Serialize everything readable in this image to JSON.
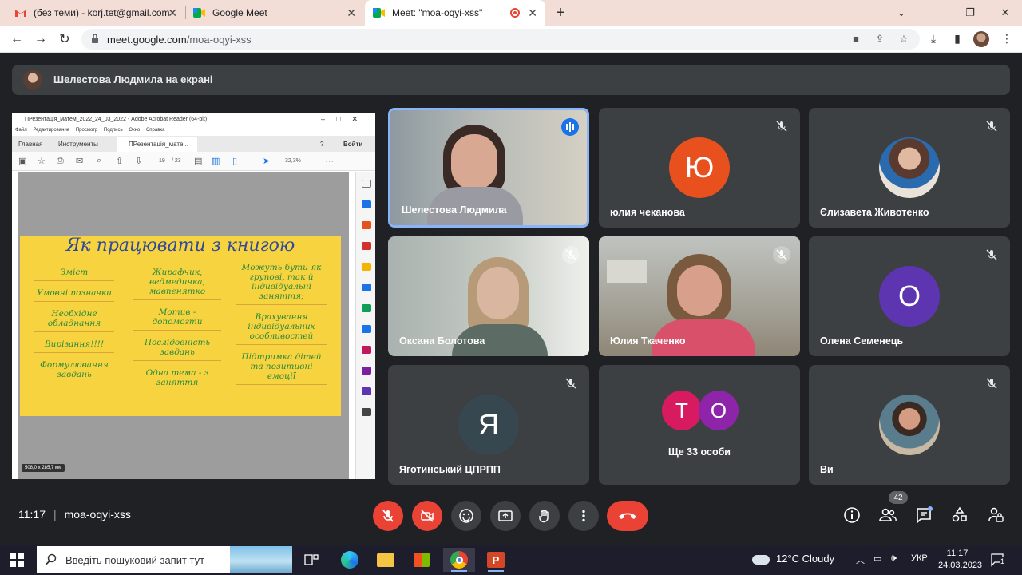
{
  "browser": {
    "tabs": [
      {
        "title": "(без теми) - korj.tet@gmail.com",
        "icon": "gmail-icon"
      },
      {
        "title": "Google Meet",
        "icon": "meet-icon"
      },
      {
        "title": "Meet: \"moa-oqyi-xss\"",
        "icon": "meet-icon",
        "active": true
      }
    ],
    "url_host": "meet.google.com",
    "url_path": "/moa-oqyi-xss"
  },
  "banner": {
    "text": "Шелестова Людмила на екрані"
  },
  "presentation": {
    "app_title": "ПРезентація_матем_2022_24_03_2022 - Adobe Acrobat Reader (64-bit)",
    "menu": [
      "Файл",
      "Редактирование",
      "Просмотр",
      "Подпись",
      "Окно",
      "Справка"
    ],
    "tabs": {
      "home": "Главная",
      "tools": "Инструменты",
      "doc": "ПРезентація_мате...",
      "login": "Войти"
    },
    "page_current": "19",
    "page_total": "/ 23",
    "zoom": "32,3%",
    "page_size": "508,0 x 285,7 мм",
    "slide": {
      "title": "Як працювати з книгою",
      "col1": [
        "Зміст",
        "Умовні позначки",
        "Необхідне обладнання",
        "Вирізання!!!!",
        "Формулювання завдань"
      ],
      "col2": [
        "Жирафчик, ведмедичка, мавпенятко",
        "Мотив - допомогти",
        "Послідовність завдань",
        "Одна тема - з заняття"
      ],
      "col3": [
        "Можуть бути як групові, так й індивідуальні заняття;",
        "Врахування індивідуальних особливостей",
        "Підтримка дітей та позитивні емоції"
      ]
    }
  },
  "participants": [
    {
      "name": "Шелестова Людмила",
      "type": "video",
      "speaking": true
    },
    {
      "name": "юлия чеканова",
      "type": "letter",
      "letter": "Ю",
      "color": "#e8501e",
      "muted": true
    },
    {
      "name": "Єлизавета Животенко",
      "type": "photo",
      "muted": true
    },
    {
      "name": "Оксана Болотова",
      "type": "video",
      "muted": true
    },
    {
      "name": "Юлия Ткаченко",
      "type": "video",
      "muted": true
    },
    {
      "name": "Олена Семенець",
      "type": "letter",
      "letter": "О",
      "color": "#5e35b1",
      "muted": true
    },
    {
      "name": "Яготинський ЦПРПП",
      "type": "letter",
      "letter": "Я",
      "color": "#37474f",
      "muted": true
    },
    {
      "name": "Ще 33 особи",
      "type": "group",
      "letters": [
        "Т",
        "О"
      ],
      "colors": [
        "#d81b60",
        "#8e24aa"
      ]
    },
    {
      "name": "Ви",
      "type": "photo",
      "muted": true
    }
  ],
  "meeting": {
    "time": "11:17",
    "code": "moa-oqyi-xss",
    "people_count": "42"
  },
  "taskbar": {
    "search_placeholder": "Введіть пошуковий запит тут",
    "weather": "12°C  Cloudy",
    "lang": "УКР",
    "time": "11:17",
    "date": "24.03.2023",
    "notifications": "1"
  }
}
